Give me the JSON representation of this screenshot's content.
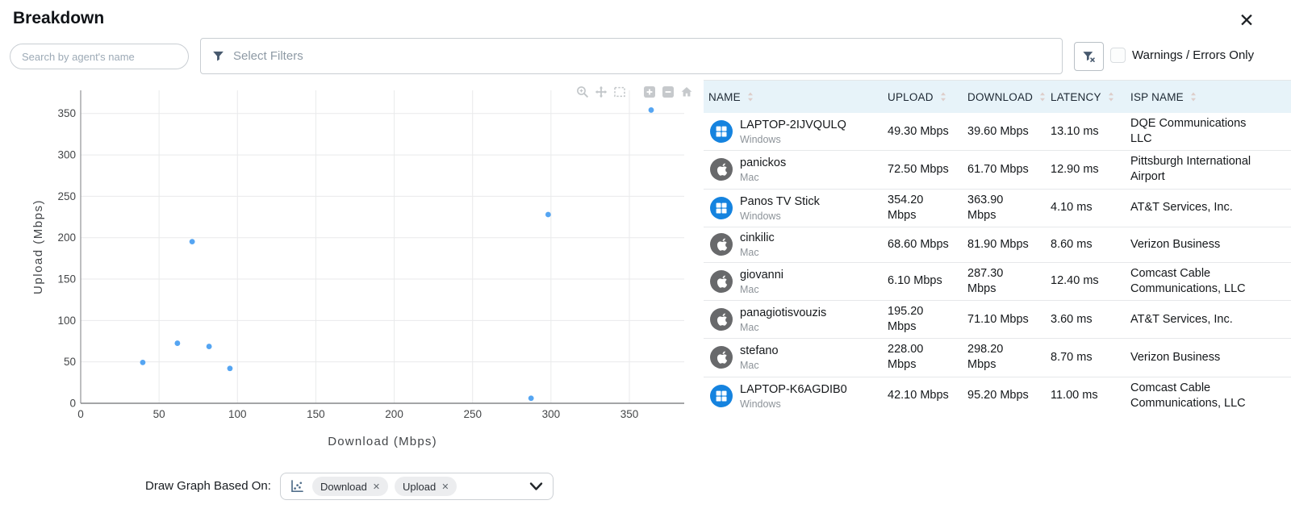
{
  "header": {
    "title": "Breakdown",
    "close_icon": "close-x"
  },
  "toolbar": {
    "search_placeholder": "Search by agent's name",
    "filter_placeholder": "Select Filters",
    "filter_icon": "funnel-icon",
    "clear_filter_icon": "funnel-x-icon",
    "warnings_label": "Warnings / Errors Only",
    "warnings_checked": false
  },
  "chart_toolbar": {
    "icons": [
      "zoom-icon",
      "pan-icon",
      "box-select-icon",
      "zoom-in-icon",
      "zoom-out-icon",
      "reset-axes-icon"
    ]
  },
  "chart_data": {
    "type": "scatter",
    "title": "",
    "xlabel": "Download (Mbps)",
    "ylabel": "Upload (Mbps)",
    "xlim": [
      0,
      385
    ],
    "ylim": [
      0,
      378
    ],
    "xticks": [
      0,
      50,
      100,
      150,
      200,
      250,
      300,
      350
    ],
    "yticks": [
      0,
      50,
      100,
      150,
      200,
      250,
      300,
      350
    ],
    "grid": true,
    "legend": false,
    "marker_color": "#55a5f2",
    "points": [
      {
        "x": 39.6,
        "y": 49.3
      },
      {
        "x": 61.7,
        "y": 72.5
      },
      {
        "x": 71.1,
        "y": 195.2
      },
      {
        "x": 81.9,
        "y": 68.6
      },
      {
        "x": 95.2,
        "y": 42.1
      },
      {
        "x": 287.3,
        "y": 6.1
      },
      {
        "x": 298.2,
        "y": 228.0
      },
      {
        "x": 363.9,
        "y": 354.2
      }
    ]
  },
  "graph_based_on": {
    "label": "Draw Graph Based On:",
    "selector_icon": "scatter-plot-icon",
    "tags": [
      {
        "label": "Download",
        "remove_icon": "✕"
      },
      {
        "label": "Upload",
        "remove_icon": "✕"
      }
    ],
    "chevron_icon": "chevron-down-icon"
  },
  "table": {
    "columns": [
      "NAME",
      "UPLOAD",
      "DOWNLOAD",
      "LATENCY",
      "ISP NAME"
    ],
    "sort_icon": "sort-carets-icon",
    "rows": [
      {
        "name": "LAPTOP-2IJVQULQ",
        "os": "Windows",
        "upload": "49.30 Mbps",
        "download": "39.60 Mbps",
        "latency": "13.10 ms",
        "isp": "DQE Communications LLC"
      },
      {
        "name": "panickos",
        "os": "Mac",
        "upload": "72.50 Mbps",
        "download": "61.70 Mbps",
        "latency": "12.90 ms",
        "isp": "Pittsburgh International Airport"
      },
      {
        "name": "Panos TV Stick",
        "os": "Windows",
        "upload": "354.20 Mbps",
        "download": "363.90 Mbps",
        "latency": "4.10 ms",
        "isp": "AT&T Services, Inc."
      },
      {
        "name": "cinkilic",
        "os": "Mac",
        "upload": "68.60 Mbps",
        "download": "81.90 Mbps",
        "latency": "8.60 ms",
        "isp": "Verizon Business"
      },
      {
        "name": "giovanni",
        "os": "Mac",
        "upload": "6.10 Mbps",
        "download": "287.30 Mbps",
        "latency": "12.40 ms",
        "isp": "Comcast Cable Communications, LLC"
      },
      {
        "name": "panagiotisvouzis",
        "os": "Mac",
        "upload": "195.20 Mbps",
        "download": "71.10 Mbps",
        "latency": "3.60 ms",
        "isp": "AT&T Services, Inc."
      },
      {
        "name": "stefano",
        "os": "Mac",
        "upload": "228.00 Mbps",
        "download": "298.20 Mbps",
        "latency": "8.70 ms",
        "isp": "Verizon Business"
      },
      {
        "name": "LAPTOP-K6AGDIB0",
        "os": "Windows",
        "upload": "42.10 Mbps",
        "download": "95.20 Mbps",
        "latency": "11.00 ms",
        "isp": "Comcast Cable Communications, LLC"
      }
    ]
  },
  "colors": {
    "marker": "#55a5f2",
    "table_header_bg": "#e7f3f9",
    "windows_badge": "#1583df",
    "mac_badge": "#68696b",
    "grid_line": "#e9eaeb",
    "axis_line": "#85878a",
    "modebar_icon": "#c2c6c9"
  }
}
